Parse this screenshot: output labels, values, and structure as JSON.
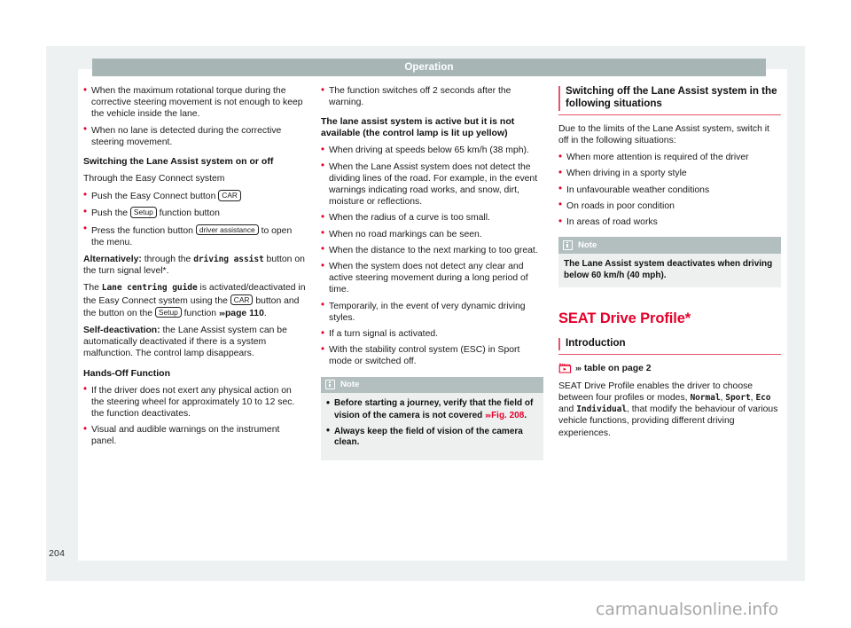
{
  "page": {
    "running_header": "Operation",
    "folio": "204",
    "watermark": "carmanualsonline.info"
  },
  "col1": {
    "bullets_top": [
      "When the maximum rotational torque during the corrective steering movement is not enough to keep the vehicle inside the lane.",
      "When no lane is detected during the corrective steering movement."
    ],
    "heading_switching": "Switching the Lane Assist system on or off",
    "through_easy_connect": "Through the Easy Connect system",
    "steps": [
      {
        "pre": "Push the Easy Connect button ",
        "chip": "CAR",
        "post": ""
      },
      {
        "pre": "Push the ",
        "chip": "Setup",
        "post": " function button"
      },
      {
        "pre": "Press the function button ",
        "chip": "driver assistance",
        "post": " to open the menu."
      }
    ],
    "alternatively_label": "Alternatively:",
    "alternatively_mid": " through the ",
    "alternatively_mono": "driving assist",
    "alternatively_post": " button on the turn signal level*.",
    "lane_centring_pre": "The ",
    "lane_centring_mono": "Lane centring guide",
    "lane_centring_mid": " is activated/deactivated in the Easy Connect system using the ",
    "lane_centring_chip1": "CAR",
    "lane_centring_mid2": " button and the button on the ",
    "lane_centring_chip2": "Setup",
    "lane_centring_mid3": " function ",
    "lane_centring_xref": "page 110",
    "lane_centring_end": ".",
    "self_deact_label": "Self-deactivation:",
    "self_deact_text": " the Lane Assist system can be automatically deactivated if there is a system malfunction. The control lamp disappears.",
    "heading_hands_off": "Hands-Off Function",
    "hands_off_bullets": [
      "If the driver does not exert any physical action on the steering wheel for approximately 10 to 12 sec. the function deactivates.",
      "Visual and audible warnings on the instrument panel."
    ]
  },
  "col2": {
    "bullet_top": "The function switches off 2 seconds after the warning.",
    "heading_active_not_available": "The lane assist system is active but it is not available (the control lamp is lit up yellow)",
    "bullets": [
      "When driving at speeds below 65 km/h (38 mph).",
      "When the Lane Assist system does not detect the dividing lines of the road. For example, in the event warnings indicating road works, and snow, dirt, moisture or reflections.",
      "When the radius of a curve is too small.",
      "When no road markings can be seen.",
      "When the distance to the next marking to too great.",
      "When the system does not detect any clear and active steering movement during a long period of time.",
      "Temporarily, in the event of very dynamic driving styles.",
      "If a turn signal is activated.",
      "With the stability control system (ESC) in Sport mode or switched off."
    ],
    "note": {
      "title": "Note",
      "bullet1_pre": "Before starting a journey, verify that the field of vision of the camera is not covered ",
      "bullet1_xref": "Fig. 208",
      "bullet1_post": ".",
      "bullet2": "Always keep the field of vision of the camera clean."
    }
  },
  "col3": {
    "heading_switching_off": "Switching off the Lane Assist system in the following situations",
    "intro": "Due to the limits of the Lane Assist system, switch it off in the following situations:",
    "bullets": [
      "When more attention is required of the driver",
      "When driving in a sporty style",
      "In unfavourable weather conditions",
      "On roads in poor condition",
      "In areas of road works"
    ],
    "note": {
      "title": "Note",
      "body": "The Lane Assist system deactivates when driving below 60 km/h (40 mph)."
    },
    "drive_profile_title": "SEAT Drive Profile*",
    "introduction_heading": "Introduction",
    "table_xref": "table on page 2",
    "intro_pre": "SEAT Drive Profile enables the driver to choose between four profiles or modes, ",
    "mode1": "Normal",
    "sep1": ", ",
    "mode2": "Sport",
    "sep2": ", ",
    "mode3": "Eco",
    "sep3": " and ",
    "mode4": "Individual",
    "intro_post": ", that modify the behaviour of various vehicle functions, providing different driving experiences."
  },
  "colors": {
    "brand_red": "#e4002b",
    "rule_red": "#e8536b",
    "header_gray": "#a7b5b5",
    "note_head": "#b3bfbf",
    "note_body": "#eef0f0",
    "page_bg": "#eef1f2"
  }
}
